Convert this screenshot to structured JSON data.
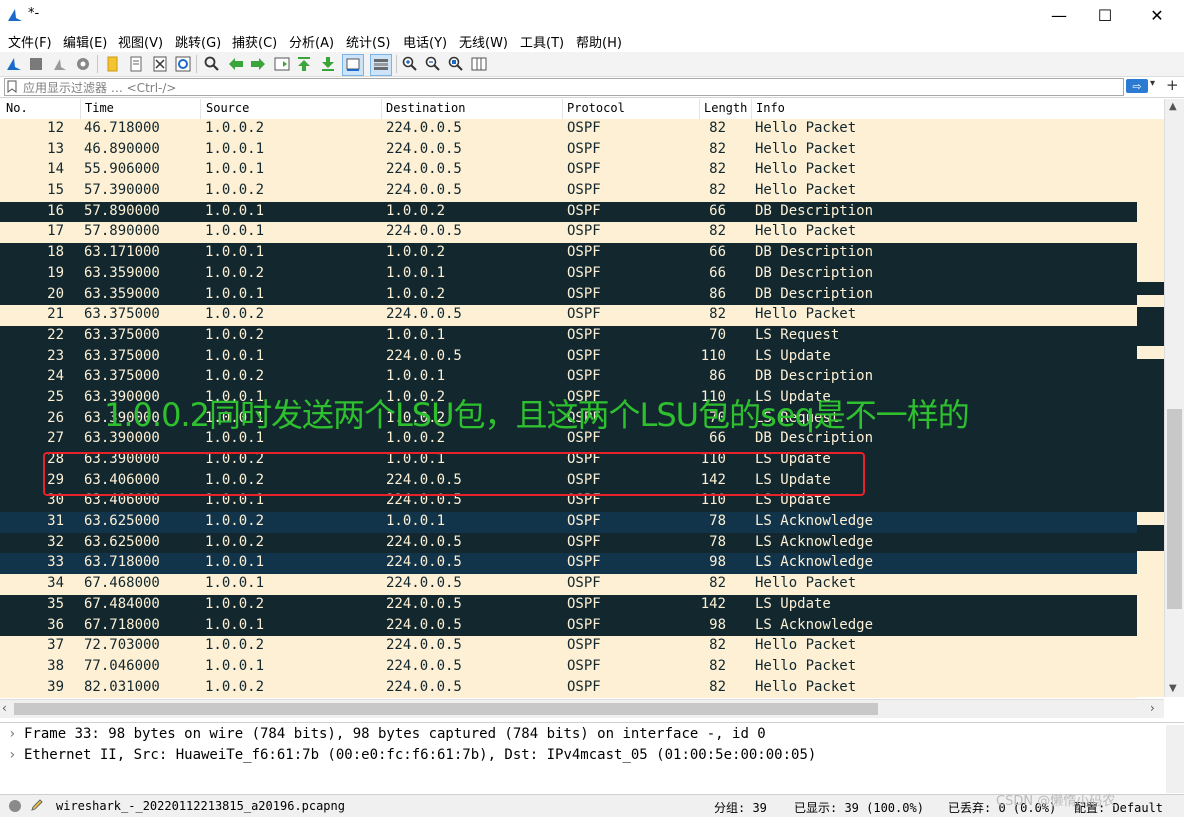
{
  "window": {
    "title": "*-",
    "minimize_glyph": "—",
    "maximize_glyph": "☐",
    "close_glyph": "✕"
  },
  "menu": [
    "文件(F)",
    "编辑(E)",
    "视图(V)",
    "跳转(G)",
    "捕获(C)",
    "分析(A)",
    "统计(S)",
    "电话(Y)",
    "无线(W)",
    "工具(T)",
    "帮助(H)"
  ],
  "toolbar_icons": [
    "shark-fin-start-icon",
    "stop-capture-icon",
    "restart-capture-icon",
    "capture-options-icon",
    "open-file-icon",
    "save-file-icon",
    "close-file-icon",
    "reload-file-icon",
    "find-packet-icon",
    "go-back-icon",
    "go-forward-icon",
    "go-to-packet-icon",
    "go-first-icon",
    "go-last-icon",
    "auto-scroll-icon",
    "colorize-icon",
    "zoom-in-icon",
    "zoom-out-icon",
    "zoom-normal-icon",
    "resize-columns-icon"
  ],
  "filter": {
    "placeholder": "应用显示过滤器 … <Ctrl-/>",
    "apply_glyph": "⇨",
    "dropdown_glyph": "▾",
    "add_glyph": "+"
  },
  "columns": [
    "No.",
    "Time",
    "Source",
    "Destination",
    "Protocol",
    "Length",
    "Info"
  ],
  "colors": {
    "hello_bg": "#fdf0d5",
    "hello_fg": "#12272e",
    "dark_bg": "#12272e",
    "dark_fg": "#fdf0d5",
    "ack_bg": "#12344a",
    "annotation": "#2ec02e",
    "highlight": "#e8212a"
  },
  "packets": [
    {
      "no": "12",
      "time": "46.718000",
      "src": "1.0.0.2",
      "dst": "224.0.0.5",
      "proto": "OSPF",
      "len": "82",
      "info": "Hello Packet",
      "style": "hello"
    },
    {
      "no": "13",
      "time": "46.890000",
      "src": "1.0.0.1",
      "dst": "224.0.0.5",
      "proto": "OSPF",
      "len": "82",
      "info": "Hello Packet",
      "style": "hello"
    },
    {
      "no": "14",
      "time": "55.906000",
      "src": "1.0.0.1",
      "dst": "224.0.0.5",
      "proto": "OSPF",
      "len": "82",
      "info": "Hello Packet",
      "style": "hello"
    },
    {
      "no": "15",
      "time": "57.390000",
      "src": "1.0.0.2",
      "dst": "224.0.0.5",
      "proto": "OSPF",
      "len": "82",
      "info": "Hello Packet",
      "style": "hello"
    },
    {
      "no": "16",
      "time": "57.890000",
      "src": "1.0.0.1",
      "dst": "1.0.0.2",
      "proto": "OSPF",
      "len": "66",
      "info": "DB Description",
      "style": "dark"
    },
    {
      "no": "17",
      "time": "57.890000",
      "src": "1.0.0.1",
      "dst": "224.0.0.5",
      "proto": "OSPF",
      "len": "82",
      "info": "Hello Packet",
      "style": "hello"
    },
    {
      "no": "18",
      "time": "63.171000",
      "src": "1.0.0.1",
      "dst": "1.0.0.2",
      "proto": "OSPF",
      "len": "66",
      "info": "DB Description",
      "style": "dark"
    },
    {
      "no": "19",
      "time": "63.359000",
      "src": "1.0.0.2",
      "dst": "1.0.0.1",
      "proto": "OSPF",
      "len": "66",
      "info": "DB Description",
      "style": "dark"
    },
    {
      "no": "20",
      "time": "63.359000",
      "src": "1.0.0.1",
      "dst": "1.0.0.2",
      "proto": "OSPF",
      "len": "86",
      "info": "DB Description",
      "style": "dark"
    },
    {
      "no": "21",
      "time": "63.375000",
      "src": "1.0.0.2",
      "dst": "224.0.0.5",
      "proto": "OSPF",
      "len": "82",
      "info": "Hello Packet",
      "style": "hello"
    },
    {
      "no": "22",
      "time": "63.375000",
      "src": "1.0.0.2",
      "dst": "1.0.0.1",
      "proto": "OSPF",
      "len": "70",
      "info": "LS Request",
      "style": "dark"
    },
    {
      "no": "23",
      "time": "63.375000",
      "src": "1.0.0.1",
      "dst": "224.0.0.5",
      "proto": "OSPF",
      "len": "110",
      "info": "LS Update",
      "style": "dark"
    },
    {
      "no": "24",
      "time": "63.375000",
      "src": "1.0.0.2",
      "dst": "1.0.0.1",
      "proto": "OSPF",
      "len": "86",
      "info": "DB Description",
      "style": "dark"
    },
    {
      "no": "25",
      "time": "63.390000",
      "src": "1.0.0.1",
      "dst": "1.0.0.2",
      "proto": "OSPF",
      "len": "110",
      "info": "LS Update",
      "style": "dark"
    },
    {
      "no": "26",
      "time": "63.390000",
      "src": "1.0.0.1",
      "dst": "1.0.0.2",
      "proto": "OSPF",
      "len": "70",
      "info": "LS Request",
      "style": "dark"
    },
    {
      "no": "27",
      "time": "63.390000",
      "src": "1.0.0.1",
      "dst": "1.0.0.2",
      "proto": "OSPF",
      "len": "66",
      "info": "DB Description",
      "style": "dark"
    },
    {
      "no": "28",
      "time": "63.390000",
      "src": "1.0.0.2",
      "dst": "1.0.0.1",
      "proto": "OSPF",
      "len": "110",
      "info": "LS Update",
      "style": "dark"
    },
    {
      "no": "29",
      "time": "63.406000",
      "src": "1.0.0.2",
      "dst": "224.0.0.5",
      "proto": "OSPF",
      "len": "142",
      "info": "LS Update",
      "style": "dark"
    },
    {
      "no": "30",
      "time": "63.406000",
      "src": "1.0.0.1",
      "dst": "224.0.0.5",
      "proto": "OSPF",
      "len": "110",
      "info": "LS Update",
      "style": "dark"
    },
    {
      "no": "31",
      "time": "63.625000",
      "src": "1.0.0.2",
      "dst": "1.0.0.1",
      "proto": "OSPF",
      "len": "78",
      "info": "LS Acknowledge",
      "style": "ack"
    },
    {
      "no": "32",
      "time": "63.625000",
      "src": "1.0.0.2",
      "dst": "224.0.0.5",
      "proto": "OSPF",
      "len": "78",
      "info": "LS Acknowledge",
      "style": "dark"
    },
    {
      "no": "33",
      "time": "63.718000",
      "src": "1.0.0.1",
      "dst": "224.0.0.5",
      "proto": "OSPF",
      "len": "98",
      "info": "LS Acknowledge",
      "style": "ack"
    },
    {
      "no": "34",
      "time": "67.468000",
      "src": "1.0.0.1",
      "dst": "224.0.0.5",
      "proto": "OSPF",
      "len": "82",
      "info": "Hello Packet",
      "style": "hello"
    },
    {
      "no": "35",
      "time": "67.484000",
      "src": "1.0.0.2",
      "dst": "224.0.0.5",
      "proto": "OSPF",
      "len": "142",
      "info": "LS Update",
      "style": "dark"
    },
    {
      "no": "36",
      "time": "67.718000",
      "src": "1.0.0.1",
      "dst": "224.0.0.5",
      "proto": "OSPF",
      "len": "98",
      "info": "LS Acknowledge",
      "style": "dark"
    },
    {
      "no": "37",
      "time": "72.703000",
      "src": "1.0.0.2",
      "dst": "224.0.0.5",
      "proto": "OSPF",
      "len": "82",
      "info": "Hello Packet",
      "style": "hello"
    },
    {
      "no": "38",
      "time": "77.046000",
      "src": "1.0.0.1",
      "dst": "224.0.0.5",
      "proto": "OSPF",
      "len": "82",
      "info": "Hello Packet",
      "style": "hello"
    },
    {
      "no": "39",
      "time": "82.031000",
      "src": "1.0.0.2",
      "dst": "224.0.0.5",
      "proto": "OSPF",
      "len": "82",
      "info": "Hello Packet",
      "style": "hello"
    }
  ],
  "annotation_text": "1.0.0.2同时发送两个LSU包，且这两个LSU包的seq是不一样的",
  "details": [
    "Frame 33: 98 bytes on wire (784 bits), 98 bytes captured (784 bits) on interface -, id 0",
    "Ethernet II, Src: HuaweiTe_f6:61:7b (00:e0:fc:f6:61:7b), Dst: IPv4mcast_05 (01:00:5e:00:00:05)"
  ],
  "status": {
    "file": "wireshark_-_20220112213815_a20196.pcapng",
    "packets": "分组: 39",
    "displayed": "已显示: 39 (100.0%)",
    "dropped": "已丢弃: 0 (0.0%)",
    "profile": "配置: Default"
  },
  "watermark": "CSDN @懒惰小码农"
}
